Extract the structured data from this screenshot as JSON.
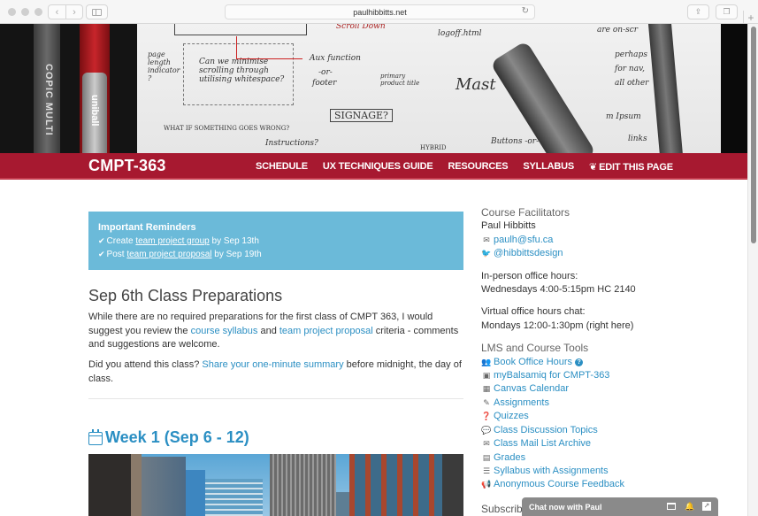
{
  "browser": {
    "url": "paulhibbitts.net",
    "back_icon": "‹",
    "forward_icon": "›",
    "reload_icon": "↻",
    "share_icon": "⇪",
    "tabs_icon": "❐",
    "newtab_icon": "+"
  },
  "hero": {
    "pen1_label": "COPIC MULTI",
    "pen2_label": "uniball",
    "sketch_texts": [
      "Scroll Down",
      "logoff.html",
      "are on-scr",
      "perhaps",
      "for nav,",
      "all other",
      "page length indicator ?",
      "Can we minimise scrolling through utilising whitespace?",
      "Aux function",
      "-or-",
      "footer",
      "primary product title",
      "Mast",
      "SIGNAGE?",
      "WHAT IF SOMETHING GOES WRONG?",
      "Instructions?",
      "Buttons -or-",
      "m Ipsum",
      "links",
      "HYBRID"
    ]
  },
  "nav": {
    "brand": "CMPT-363",
    "links": [
      "SCHEDULE",
      "UX TECHNIQUES GUIDE",
      "RESOURCES",
      "SYLLABUS",
      "EDIT THIS PAGE"
    ],
    "edit_icon": "❦",
    "colors": {
      "bar": "#a71930"
    }
  },
  "reminders": {
    "title": "Important Reminders",
    "check_icon": "✔",
    "items": [
      {
        "pre": "Create ",
        "link": "team project group",
        "post": " by Sep 13th"
      },
      {
        "pre": "Post ",
        "link": "team project proposal",
        "post": " by Sep 19th"
      }
    ],
    "color": "#6bbad9"
  },
  "prep": {
    "heading": "Sep 6th Class Preparations",
    "p1_a": "While there are no required preparations for the first class of CMPT 363, I would suggest you review the ",
    "p1_link1": "course syllabus",
    "p1_b": " and ",
    "p1_link2": "team project proposal",
    "p1_c": " criteria - comments and suggestions are welcome.",
    "p2_a": "Did you attend this class? ",
    "p2_link": "Share your one-minute summary",
    "p2_b": " before midnight, the day of class."
  },
  "week": {
    "heading": "Week 1 (Sep 6 - 12)"
  },
  "sidebar": {
    "facilitators_heading": "Course Facilitators",
    "name": "Paul Hibbitts",
    "email": "paulh@sfu.ca",
    "email_icon": "✉",
    "twitter": "@hibbittsdesign",
    "twitter_icon": "🐦",
    "inperson_label": "In-person office hours:",
    "inperson_value": "Wednesdays 4:00-5:15pm HC 2140",
    "virtual_label": "Virtual office hours chat:",
    "virtual_value": "Mondays 12:00-1:30pm (right here)",
    "tools_heading": "LMS and Course Tools",
    "tools": [
      {
        "icon": "👥",
        "label": "Book Office Hours",
        "help": "?"
      },
      {
        "icon": "▣",
        "label": "myBalsamiq for CMPT-363"
      },
      {
        "icon": "▦",
        "label": "Canvas Calendar"
      },
      {
        "icon": "✎",
        "label": "Assignments"
      },
      {
        "icon": "❓",
        "label": "Quizzes"
      },
      {
        "icon": "💬",
        "label": "Class Discussion Topics"
      },
      {
        "icon": "✉",
        "label": "Class Mail List Archive"
      },
      {
        "icon": "▤",
        "label": "Grades"
      },
      {
        "icon": "☰",
        "label": "Syllabus with Assignments"
      },
      {
        "icon": "📢",
        "label": "Anonymous Course Feedback"
      }
    ],
    "subscribe": "Subscrib"
  },
  "chat": {
    "label": "Chat now with Paul",
    "bell_icon": "🔔",
    "popout_icon": "↗"
  },
  "colors": {
    "link": "#2b8fc3",
    "text": "#333333"
  }
}
